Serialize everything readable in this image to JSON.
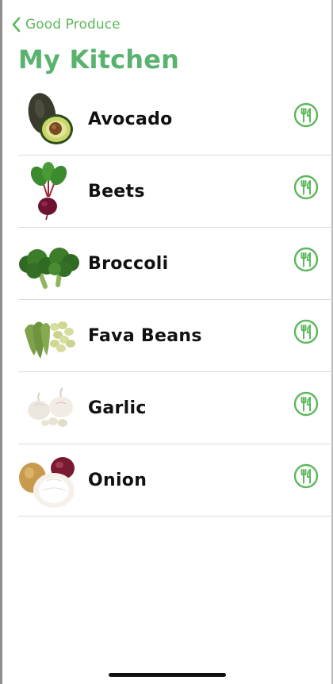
{
  "nav": {
    "back_label": "Good Produce",
    "back_icon": "chevron-left-icon"
  },
  "page": {
    "title": "My Kitchen"
  },
  "items": [
    {
      "name": "Avocado"
    },
    {
      "name": "Beets"
    },
    {
      "name": "Broccoli"
    },
    {
      "name": "Fava Beans"
    },
    {
      "name": "Garlic"
    },
    {
      "name": "Onion"
    }
  ],
  "action_icon": "fork-knife-icon",
  "colors": {
    "accent": "#5cb85c",
    "title": "#5ab26f",
    "text": "#111111",
    "divider": "#dcdcdc"
  }
}
